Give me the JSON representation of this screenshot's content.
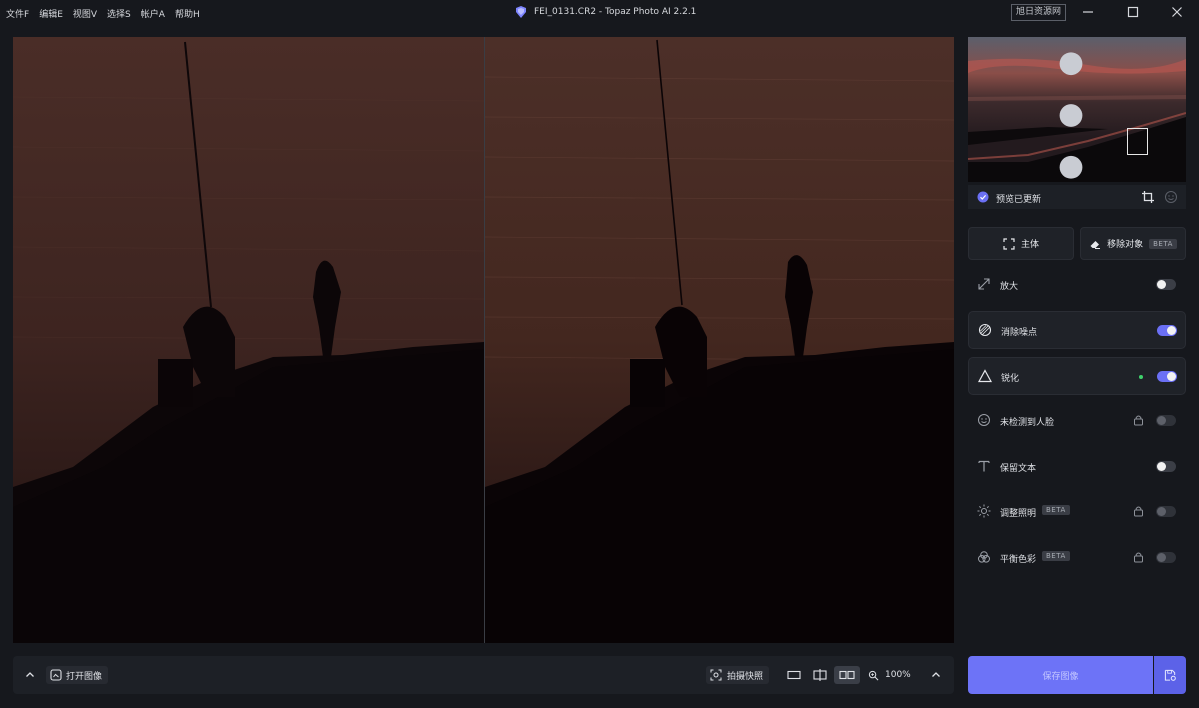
{
  "menu": [
    "文件F",
    "编辑E",
    "视图V",
    "选择S",
    "帐户A",
    "帮助H"
  ],
  "window": {
    "title": "FEI_0131.CR2 - Topaz Photo AI 2.2.1",
    "watermark": "旭日资源网"
  },
  "preview": {
    "status": "预览已更新"
  },
  "tools": {
    "subject_label": "主体",
    "remove_label": "移除对象",
    "remove_badge": "BETA"
  },
  "features": [
    {
      "label": "放大",
      "state": "off",
      "icon": "upscale-icon"
    },
    {
      "label": "消除噪点",
      "state": "on",
      "icon": "denoise-icon"
    },
    {
      "label": "锐化",
      "state": "on",
      "icon": "sharpen-icon"
    },
    {
      "label": "未检测到人脸",
      "state": "locked",
      "icon": "face-icon"
    },
    {
      "label": "保留文本",
      "state": "off",
      "icon": "text-icon"
    },
    {
      "label": "调整照明",
      "badge": "BETA",
      "state": "locked",
      "icon": "light-icon"
    },
    {
      "label": "平衡色彩",
      "badge": "BETA",
      "state": "locked",
      "icon": "color-icon"
    }
  ],
  "bottombar": {
    "open_label": "打开图像",
    "snapshot_label": "拍摄快照",
    "zoom": "100%"
  },
  "save": {
    "label": "保存图像"
  },
  "colors": {
    "accent": "#6d73f7",
    "toggle_on": "#6b70f5",
    "background": "#16181d",
    "panel": "#1f2228",
    "green_dot": "#3fd16b"
  }
}
